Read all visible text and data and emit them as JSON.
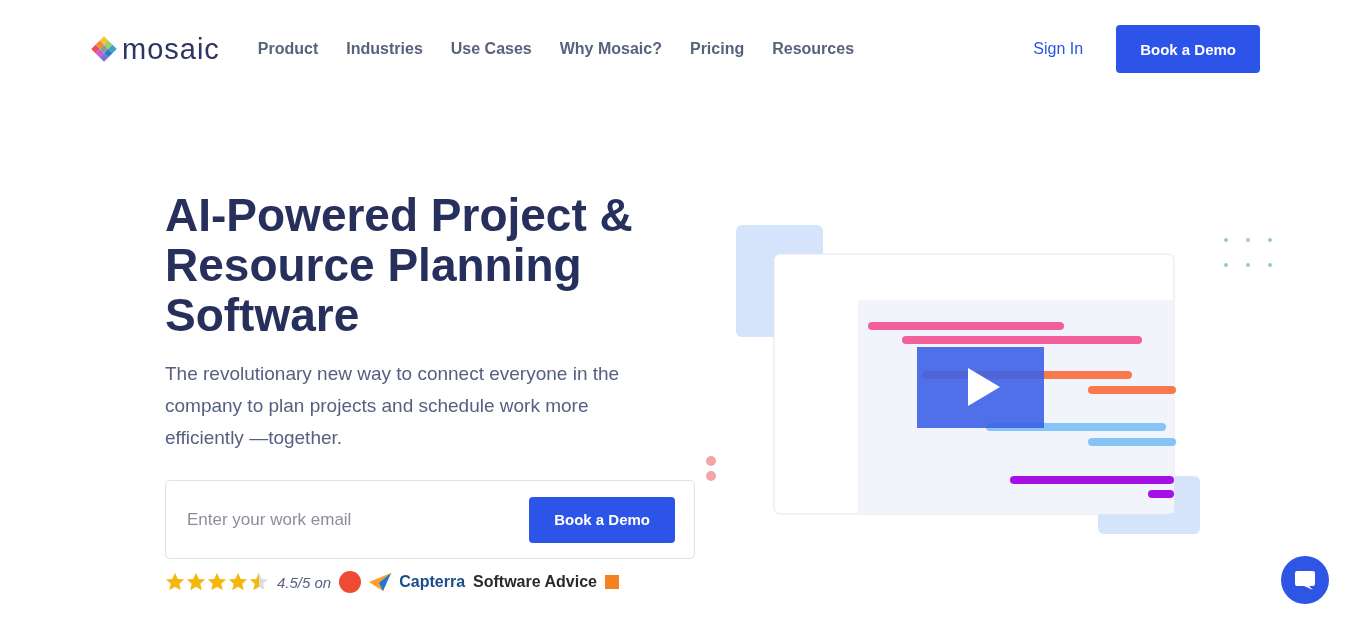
{
  "nav": {
    "logo": "mosaic",
    "links": [
      "Product",
      "Industries",
      "Use Cases",
      "Why Mosaic?",
      "Pricing",
      "Resources"
    ],
    "sign_in": "Sign In",
    "cta": "Book a Demo"
  },
  "hero": {
    "title": "AI-Powered Project & Resource Planning Software",
    "subtitle": "The revolutionary new way to connect everyone in the company to plan projects and schedule work more efficiently —together.",
    "form": {
      "placeholder": "Enter your work email",
      "button": "Book a Demo"
    },
    "rating": {
      "stars": 4.5,
      "text": "4.5/5 on",
      "sources": [
        "Capterra",
        "Software Advice"
      ]
    }
  }
}
